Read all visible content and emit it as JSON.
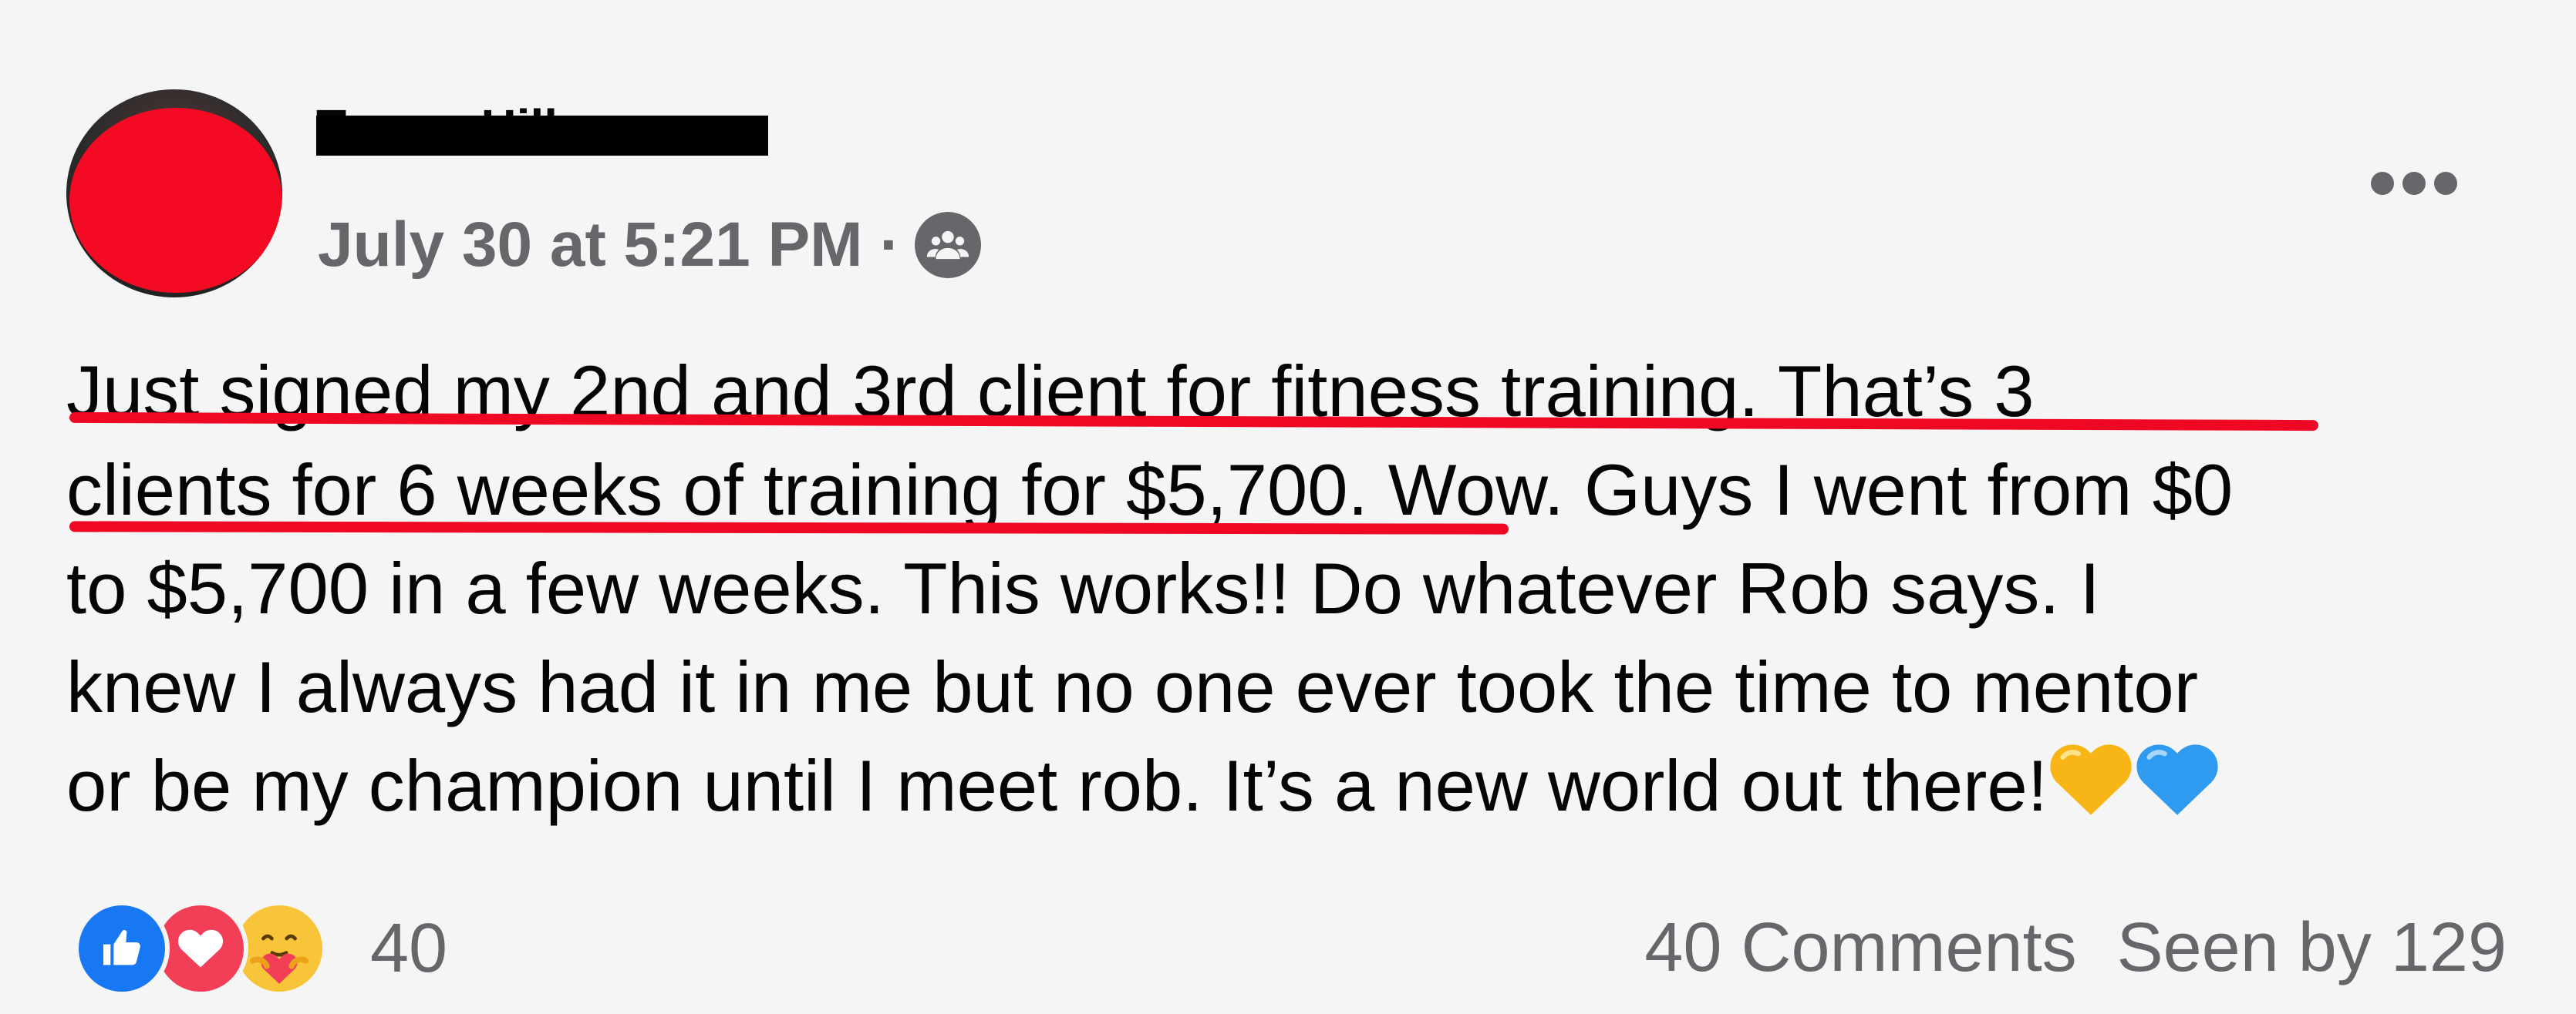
{
  "post": {
    "author_name": "Trevor Hill",
    "timestamp": "July 30 at 5:21 PM",
    "separator": "·",
    "audience_icon": "group-icon",
    "more_icon": "more-options-icon",
    "body_lines": [
      "Just signed my 2nd and 3rd client for fitness training. That’s 3",
      "clients for 6 weeks of training for $5,700",
      ". Wow. Guys I went from $0",
      "to $5,700 in a few weeks. This works!! Do whatever Rob says. I",
      "knew I always had it in me but no one ever took the time to mentor",
      "or be my champion until I meet rob. It’s a new world out there!"
    ],
    "emoji": [
      "yellow-heart-icon",
      "blue-heart-icon"
    ],
    "redaction_color": "#f50a23",
    "underline_color": "#ee0824"
  },
  "footer": {
    "reactions": [
      "like-icon",
      "love-icon",
      "care-icon"
    ],
    "reaction_count": "40",
    "comments": "40 Comments",
    "seen_by": "Seen by 129"
  },
  "colors": {
    "text": "#050505",
    "meta": "#65676b",
    "background": "#f5f5f6",
    "like": "#1877f2",
    "love": "#f33e58"
  }
}
